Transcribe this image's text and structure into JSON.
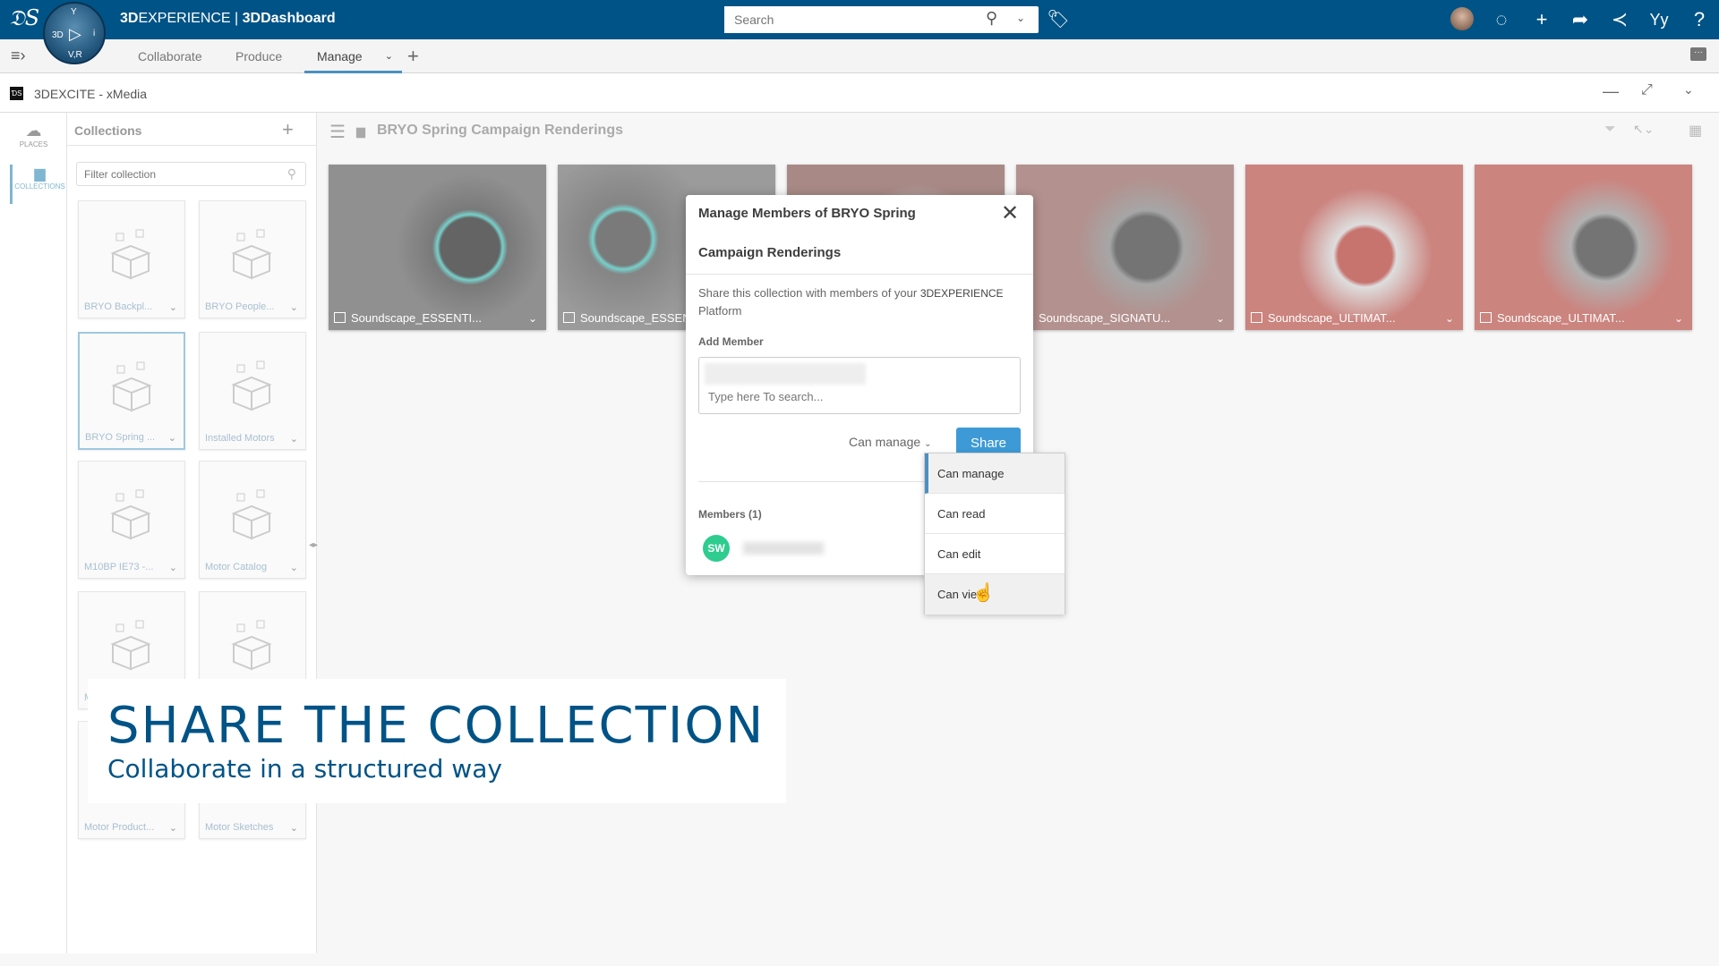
{
  "topbar": {
    "brand_bold": "3D",
    "brand_rest": "EXPERIENCE | ",
    "brand_app": "3DDashboard",
    "search_placeholder": "Search",
    "compass": {
      "top": "Y",
      "left": "3D",
      "right": "i",
      "bottom": "V,R"
    }
  },
  "nav": {
    "tabs": [
      "Collaborate",
      "Produce",
      "Manage"
    ]
  },
  "app": {
    "title": "3DEXCITE - xMedia"
  },
  "rail": {
    "places": "PLACES",
    "collections": "COLLECTIONS"
  },
  "collections": {
    "title": "Collections",
    "filter_placeholder": "Filter collection",
    "items": [
      "BRYO Backpl...",
      "BRYO People...",
      "BRYO Spring ...",
      "Installed Motors",
      "M10BP IE73 -...",
      "Motor Catalog",
      "M",
      "",
      "Motor Product...",
      "Motor Sketches"
    ]
  },
  "content": {
    "title": "BRYO Spring Campaign Renderings",
    "thumbs": [
      "Soundscape_ESSENTI...",
      "Soundscape_ESSEN",
      "",
      "Soundscape_SIGNATU...",
      "Soundscape_ULTIMAT...",
      "Soundscape_ULTIMAT..."
    ]
  },
  "dialog": {
    "title_line1": "Manage Members of BRYO Spring",
    "title_line2": "Campaign Renderings",
    "description": "Share this collection with members of your ",
    "description_brand": "3DEXPERIENCE",
    "description_end": "Platform",
    "add_member_label": "Add Member",
    "search_placeholder": "Type here To search...",
    "role_selected": "Can manage",
    "share_label": "Share",
    "members_label": "Members (1)",
    "member_initials": "SW",
    "member_color": "#2ecc8f"
  },
  "role_menu": [
    "Can manage",
    "Can read",
    "Can edit",
    "Can view"
  ],
  "banner": {
    "headline": "SHARE THE COLLECTION",
    "subline": "Collaborate in a structured way"
  },
  "colors": {
    "brand": "#005386",
    "accent": "#3d9ad6"
  }
}
